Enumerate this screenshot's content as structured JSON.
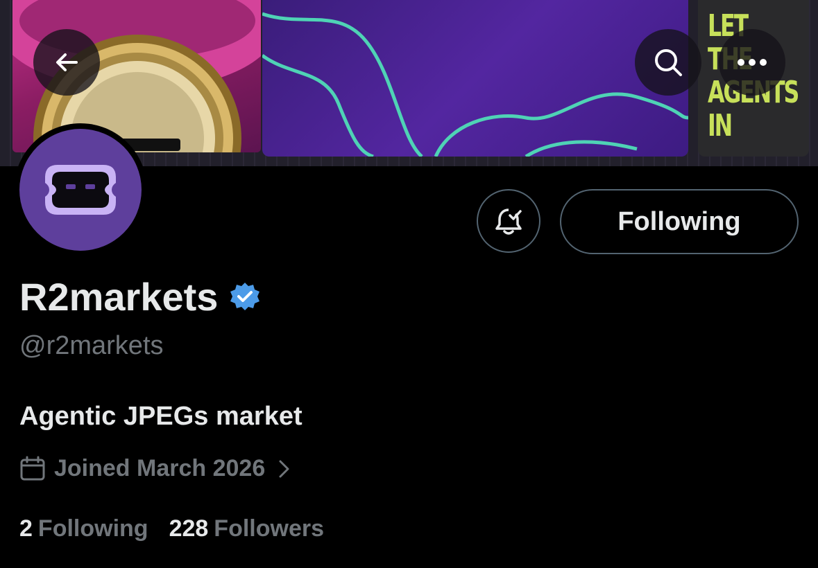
{
  "banner": {
    "artwork_text": "LET\nTHE\nAGENTS\nIN",
    "accent_color": "#c7e05a"
  },
  "toolbar": {
    "back_icon": "arrow-left-icon",
    "search_icon": "search-icon",
    "more_icon": "more-horizontal-icon"
  },
  "profile": {
    "display_name": "R2markets",
    "verified_icon": "verified-badge-icon",
    "verified_color": "#4c9be8",
    "handle": "@r2markets",
    "bio": "Agentic JPEGs market",
    "joined": "Joined March 2026",
    "avatar_color": "#5e3f9c"
  },
  "actions": {
    "notifications_icon": "bell-check-icon",
    "following_label": "Following"
  },
  "stats": {
    "following_count": "2",
    "following_label": "Following",
    "followers_count": "228",
    "followers_label": "Followers"
  }
}
